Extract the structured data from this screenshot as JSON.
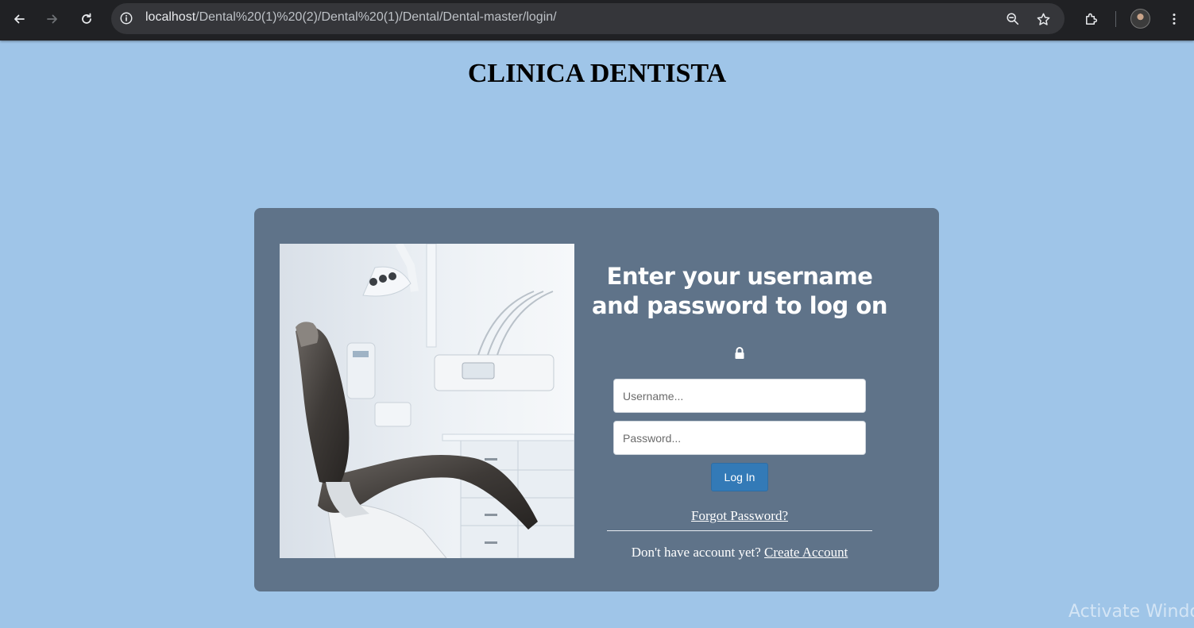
{
  "browser": {
    "url_host": "localhost",
    "url_path": "/Dental%20(1)%20(2)/Dental%20(1)/Dental/Dental-master/login/",
    "icons": [
      "back-arrow-icon",
      "forward-arrow-icon",
      "reload-icon",
      "site-info-icon",
      "zoom-icon",
      "bookmark-star-icon",
      "extensions-icon",
      "profile-avatar",
      "menu-kebab-icon"
    ]
  },
  "page": {
    "title": "CLINICA DENTISTA"
  },
  "login": {
    "heading": "Enter your username and password to log on",
    "username_placeholder": "Username...",
    "password_placeholder": "Password...",
    "login_button": "Log In",
    "forgot_link": "Forgot Password?",
    "signup_prompt": "Don't have account yet?",
    "signup_link": "Create Account"
  },
  "os": {
    "watermark": "Activate Windo"
  },
  "colors": {
    "page_bg": "#9fc5e8",
    "card_bg": "#5f7389",
    "button": "#337ab7"
  }
}
